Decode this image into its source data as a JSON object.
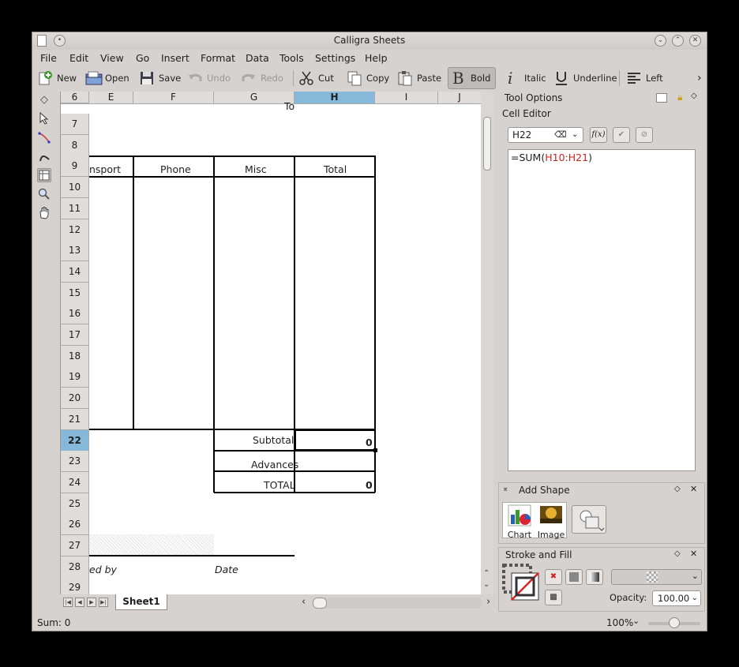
{
  "window": {
    "title": "Calligra Sheets"
  },
  "menu": [
    "File",
    "Edit",
    "View",
    "Go",
    "Insert",
    "Format",
    "Data",
    "Tools",
    "Settings",
    "Help"
  ],
  "toolbar": {
    "new": "New",
    "open": "Open",
    "save": "Save",
    "undo": "Undo",
    "redo": "Redo",
    "cut": "Cut",
    "copy": "Copy",
    "paste": "Paste",
    "bold": "Bold",
    "italic": "Italic",
    "underline": "Underline",
    "left": "Left",
    "more": "›"
  },
  "columns": [
    {
      "label": "E",
      "selected": false
    },
    {
      "label": "F",
      "selected": false
    },
    {
      "label": "G",
      "selected": false
    },
    {
      "label": "H",
      "selected": true
    },
    {
      "label": "I",
      "selected": false
    },
    {
      "label": "J",
      "selected": false
    }
  ],
  "rows": [
    "6",
    "7",
    "8",
    "9",
    "10",
    "11",
    "12",
    "13",
    "14",
    "15",
    "16",
    "17",
    "18",
    "19",
    "20",
    "21",
    "22",
    "23",
    "24",
    "25",
    "26",
    "27",
    "28",
    "29"
  ],
  "selected_row": "22",
  "cells": {
    "to": "To",
    "transport": "nsport",
    "phone": "Phone",
    "misc": "Misc",
    "total_header": "Total",
    "subtotal_label": "Subtotal",
    "subtotal_value": "0",
    "advances_label": "Advances",
    "total_label": "TOTAL",
    "total_value": "0",
    "approved_by": "ed by",
    "date": "Date"
  },
  "sheet_tab": "Sheet1",
  "tool_options": {
    "title": "Tool Options",
    "cell_editor_label": "Cell Editor",
    "cell_ref": "H22",
    "formula_prefix": "=SUM(",
    "formula_range": "H10:H21",
    "formula_suffix": ")",
    "fx_label": "f(x)"
  },
  "add_shape": {
    "title": "Add Shape",
    "chart": "Chart",
    "image": "Image"
  },
  "stroke_fill": {
    "title": "Stroke and Fill",
    "opacity_label": "Opacity:",
    "opacity_value": "100.00"
  },
  "status": {
    "sum": "Sum: 0",
    "zoom": "100%"
  },
  "colors": {
    "selection": "#86b9d9",
    "window_bg": "#d6d2d0",
    "formula_ref": "#d21e1e"
  }
}
